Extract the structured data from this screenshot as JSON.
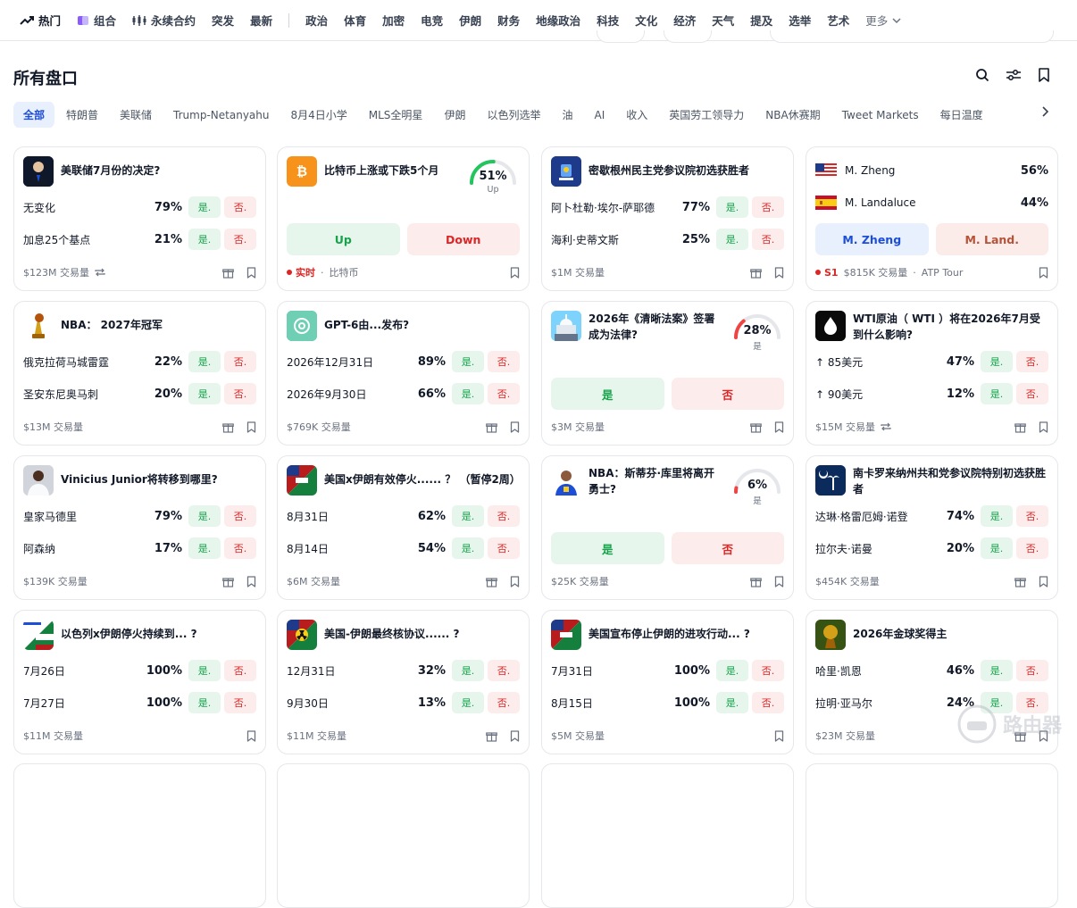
{
  "nav": {
    "items": [
      {
        "label": "热门",
        "icon": "trending-icon"
      },
      {
        "label": "组合",
        "icon": "combo-icon"
      },
      {
        "label": "永续合约",
        "icon": "perpetual-icon"
      },
      {
        "label": "突发"
      },
      {
        "label": "最新"
      }
    ],
    "topics": [
      "政治",
      "体育",
      "加密",
      "电竞",
      "伊朗",
      "财务",
      "地缘政治",
      "科技",
      "文化",
      "经济",
      "天气",
      "提及",
      "选举",
      "艺术"
    ],
    "more": "更多"
  },
  "page": {
    "title": "所有盘口"
  },
  "filters": [
    "全部",
    "特朗普",
    "美联储",
    "Trump-Netanyahu",
    "8月4日小学",
    "MLS全明星",
    "伊朗",
    "以色列选举",
    "油",
    "AI",
    "收入",
    "英国劳工领导力",
    "NBA休赛期",
    "Tweet Markets",
    "每日温度"
  ],
  "labels": {
    "yes": "是.",
    "no": "否."
  },
  "cards": [
    {
      "title": "美联储7月份的决定?",
      "icon": "fed-chair-icon",
      "outcomes": [
        {
          "name": "无变化",
          "pct": "79%"
        },
        {
          "name": "加息25个基点",
          "pct": "21%"
        }
      ],
      "volume": "$123M 交易量"
    },
    {
      "title": "比特币上涨或下跌5个月",
      "icon": "bitcoin-icon",
      "gauge": {
        "pct": "51%",
        "label": "Up",
        "value": 0.51
      },
      "buttons": [
        "Up",
        "Down"
      ],
      "live": "实时",
      "tag": "比特币"
    },
    {
      "title": "密歇根州民主党参议院初选获胜者",
      "icon": "michigan-flag-icon",
      "outcomes": [
        {
          "name": "阿卜杜勒·埃尔-萨耶德",
          "pct": "77%"
        },
        {
          "name": "海利·史蒂文斯",
          "pct": "25%"
        }
      ],
      "volume": "$1M 交易量"
    },
    {
      "players": [
        {
          "name": "M. Zheng",
          "pct": "56%",
          "flag": "usa-flag-icon"
        },
        {
          "name": "M. Landaluce",
          "pct": "44%",
          "flag": "spain-flag-icon"
        }
      ],
      "buttons": [
        "M. Zheng",
        "M. Land."
      ],
      "live": "S1",
      "volume": "$815K 交易量",
      "tag": "ATP Tour"
    },
    {
      "title": "NBA： 2027年冠军",
      "icon": "trophy-icon",
      "outcomes": [
        {
          "name": "俄克拉荷马城雷霆",
          "pct": "22%"
        },
        {
          "name": "圣安东尼奥马刺",
          "pct": "20%"
        }
      ],
      "volume": "$13M 交易量"
    },
    {
      "title": "GPT-6由...发布?",
      "icon": "openai-icon",
      "outcomes": [
        {
          "name": "2026年12月31日",
          "pct": "89%"
        },
        {
          "name": "2026年9月30日",
          "pct": "66%"
        }
      ],
      "volume": "$769K 交易量"
    },
    {
      "title": "2026年《清晰法案》签署成为法律?",
      "icon": "capitol-icon",
      "gauge": {
        "pct": "28%",
        "label": "是",
        "value": 0.28
      },
      "buttons": [
        "是",
        "否"
      ],
      "volume": "$3M 交易量"
    },
    {
      "title": "WTI原油（ WTI ）将在2026年7月受到什么影响?",
      "icon": "oil-drop-icon",
      "outcomes": [
        {
          "name": "↑ 85美元",
          "pct": "47%"
        },
        {
          "name": "↑ 90美元",
          "pct": "12%"
        }
      ],
      "volume": "$15M 交易量"
    },
    {
      "title": "Vinicius Junior将转移到哪里?",
      "icon": "player-icon",
      "outcomes": [
        {
          "name": "皇家马德里",
          "pct": "79%"
        },
        {
          "name": "阿森纳",
          "pct": "17%"
        }
      ],
      "volume": "$139K 交易量"
    },
    {
      "title": "美国x伊朗有效停火...... ？ （暂停2周）",
      "icon": "us-iran-flag-icon",
      "outcomes": [
        {
          "name": "8月31日",
          "pct": "62%"
        },
        {
          "name": "8月14日",
          "pct": "54%"
        }
      ],
      "volume": "$6M 交易量"
    },
    {
      "title": "NBA：斯蒂芬·库里将离开勇士?",
      "icon": "curry-icon",
      "gauge": {
        "pct": "6%",
        "label": "是",
        "value": 0.06
      },
      "buttons": [
        "是",
        "否"
      ],
      "volume": "$25K 交易量"
    },
    {
      "title": "南卡罗来纳州共和党参议院特别初选获胜者",
      "icon": "south-carolina-flag-icon",
      "outcomes": [
        {
          "name": "达琳·格雷厄姆·诺登",
          "pct": "74%"
        },
        {
          "name": "拉尔夫·诺曼",
          "pct": "20%"
        }
      ],
      "volume": "$454K 交易量"
    },
    {
      "title": "以色列x伊朗停火持续到... ?",
      "icon": "israel-iran-flag-icon",
      "outcomes": [
        {
          "name": "7月26日",
          "pct": "100%"
        },
        {
          "name": "7月27日",
          "pct": "100%"
        }
      ],
      "volume": "$11M 交易量"
    },
    {
      "title": "美国-伊朗最终核协议...... ?",
      "icon": "us-iran-nuclear-icon",
      "outcomes": [
        {
          "name": "12月31日",
          "pct": "32%"
        },
        {
          "name": "9月30日",
          "pct": "13%"
        }
      ],
      "volume": "$11M 交易量"
    },
    {
      "title": "美国宣布停止伊朗的进攻行动... ?",
      "icon": "us-iran-flag-icon",
      "outcomes": [
        {
          "name": "7月31日",
          "pct": "100%"
        },
        {
          "name": "8月15日",
          "pct": "100%"
        }
      ],
      "volume": "$5M 交易量"
    },
    {
      "title": "2026年金球奖得主",
      "icon": "ballon-dor-icon",
      "outcomes": [
        {
          "name": "哈里·凯恩",
          "pct": "46%"
        },
        {
          "name": "拉明·亚马尔",
          "pct": "24%"
        }
      ],
      "volume": "$23M 交易量"
    }
  ],
  "watermark": "路由器",
  "colors": {
    "accent": "#1d4ed8",
    "yes": "#16a34a",
    "no": "#dc2626"
  }
}
